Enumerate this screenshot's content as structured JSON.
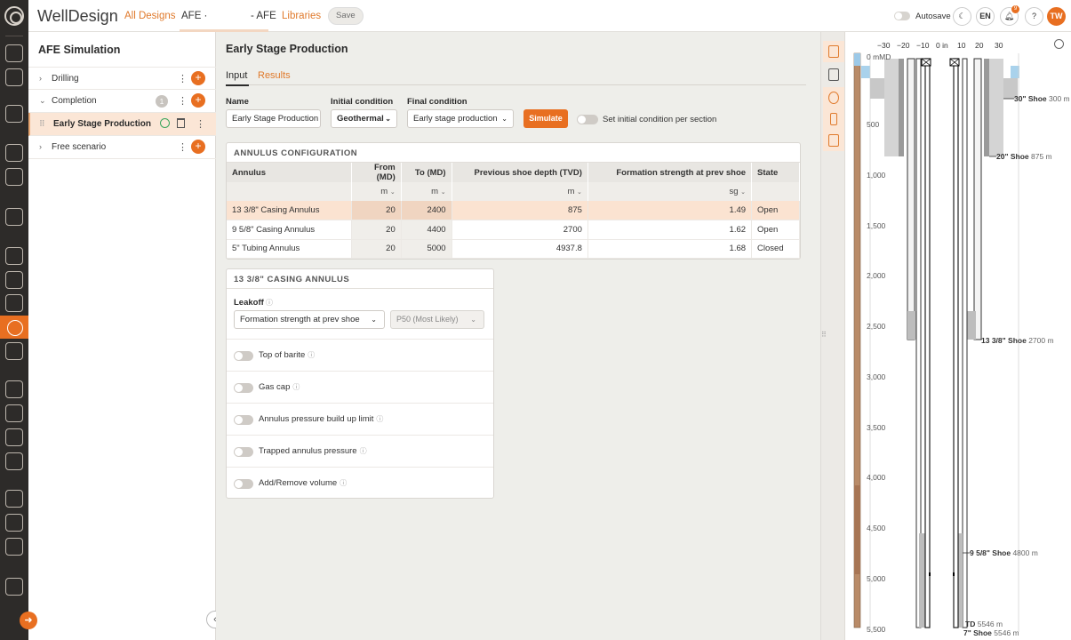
{
  "header": {
    "app_title": "WellDesign",
    "nav_all_designs": "All Designs",
    "nav_afe": "AFE ·",
    "nav_afe2": "- AFE",
    "nav_libraries": "Libraries",
    "save": "Save",
    "autosave": "Autosave",
    "lang": "EN",
    "notification_count": "9",
    "help": "?",
    "avatar": "TW"
  },
  "sidebar": {
    "title": "AFE Simulation",
    "items": [
      {
        "label": "Drilling"
      },
      {
        "label": "Completion",
        "count": "1"
      },
      {
        "label": "Early Stage Production"
      },
      {
        "label": "Free scenario"
      }
    ]
  },
  "main": {
    "title": "Early Stage Production",
    "tabs": [
      "Input",
      "Results"
    ],
    "name_label": "Name",
    "name_value": "Early Stage Production",
    "initial_label": "Initial condition",
    "initial_value": "Geothermal",
    "final_label": "Final condition",
    "final_value": "Early stage production",
    "simulate": "Simulate",
    "set_initial_label": "Set initial condition per section"
  },
  "annulus_config": {
    "title": "ANNULUS CONFIGURATION",
    "columns": [
      "Annulus",
      "From (MD)",
      "To (MD)",
      "Previous shoe depth (TVD)",
      "Formation strength at prev shoe",
      "State"
    ],
    "units": [
      "",
      "m",
      "m",
      "m",
      "sg",
      ""
    ],
    "rows": [
      [
        "13 3/8\" Casing Annulus",
        "20",
        "2400",
        "875",
        "1.49",
        "Open"
      ],
      [
        "9 5/8\" Casing Annulus",
        "20",
        "4400",
        "2700",
        "1.62",
        "Open"
      ],
      [
        "5\" Tubing Annulus",
        "20",
        "5000",
        "4937.8",
        "1.68",
        "Closed"
      ]
    ]
  },
  "leakoff_card": {
    "title": "13 3/8\" CASING ANNULUS",
    "leakoff_label": "Leakoff",
    "leakoff_value": "Formation strength at prev shoe",
    "percentile_value": "P50 (Most Likely)",
    "options": [
      "Top of barite",
      "Gas cap",
      "Annulus pressure build up limit",
      "Trapped annulus pressure",
      "Add/Remove volume"
    ]
  },
  "schematic": {
    "x_ticks": [
      "−30",
      "−20",
      "−10",
      "0 in",
      "10",
      "20",
      "30"
    ],
    "depth_label": "0 mMD",
    "y_ticks": [
      "500",
      "1,000",
      "1,500",
      "2,000",
      "2,500",
      "3,000",
      "3,500",
      "4,000",
      "4,500",
      "5,000",
      "5,500"
    ],
    "shoes": [
      {
        "name": "30\" Shoe",
        "depth": "300 m"
      },
      {
        "name": "20\" Shoe",
        "depth": "875 m"
      },
      {
        "name": "13 3/8\" Shoe",
        "depth": "2700 m"
      },
      {
        "name": "9 5/8\" Shoe",
        "depth": "4800 m"
      },
      {
        "name": "TD",
        "depth": "5546 m"
      },
      {
        "name": "7\" Shoe",
        "depth": "5546 m"
      }
    ]
  }
}
